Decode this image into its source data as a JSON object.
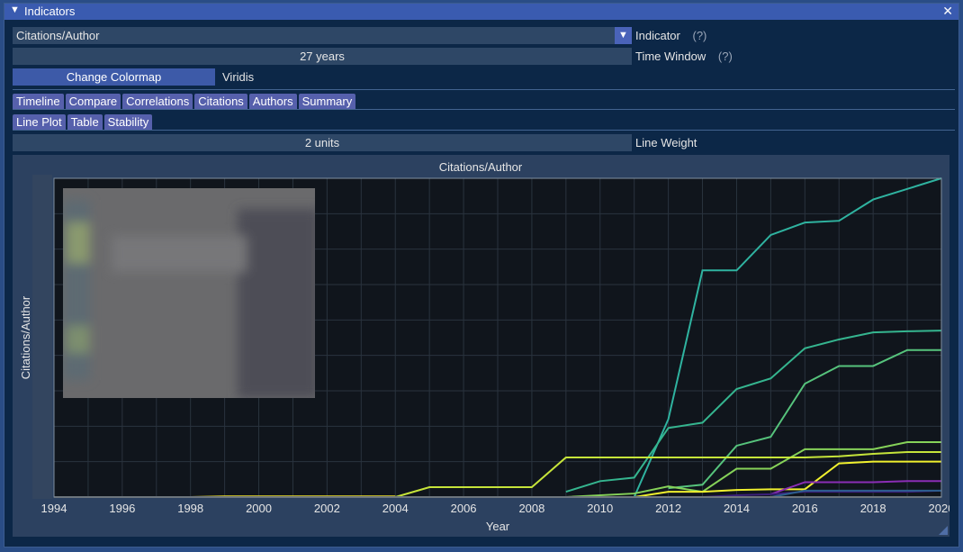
{
  "window": {
    "title": "Indicators"
  },
  "indicator": {
    "value": "Citations/Author",
    "label": "Indicator",
    "help": "(?)"
  },
  "time_window": {
    "value": "27 years",
    "label": "Time Window",
    "help": "(?)"
  },
  "colormap": {
    "button": "Change Colormap",
    "name": "Viridis"
  },
  "tabs": [
    "Timeline",
    "Compare",
    "Correlations",
    "Citations",
    "Authors",
    "Summary"
  ],
  "subtabs": [
    "Line Plot",
    "Table",
    "Stability"
  ],
  "line_weight": {
    "value": "2 units",
    "label": "Line Weight"
  },
  "chart_data": {
    "type": "line",
    "title": "Citations/Author",
    "xlabel": "Year",
    "ylabel": "Citations/Author",
    "xlim": [
      1994,
      2020
    ],
    "ylim": [
      0,
      9
    ],
    "x_ticks": [
      "1994",
      "1996",
      "1998",
      "2000",
      "2002",
      "2004",
      "2006",
      "2008",
      "2010",
      "2012",
      "2014",
      "2016",
      "2018",
      "2020"
    ],
    "grid": true,
    "legend": "top-left (blurred)",
    "series": [
      {
        "color": "#2fb3a0",
        "x": [
          2011,
          2012,
          2013,
          2014,
          2015,
          2016,
          2017,
          2018,
          2019,
          2020
        ],
        "y": [
          0,
          2.2,
          6.4,
          6.4,
          7.4,
          7.75,
          7.8,
          8.4,
          8.7,
          9.0
        ]
      },
      {
        "color": "#35b58f",
        "x": [
          2009,
          2010,
          2011,
          2012,
          2013,
          2014,
          2015,
          2016,
          2017,
          2018,
          2019,
          2020
        ],
        "y": [
          0.15,
          0.45,
          0.55,
          1.95,
          2.1,
          3.05,
          3.35,
          4.2,
          4.45,
          4.65,
          4.68,
          4.7
        ]
      },
      {
        "color": "#56c37c",
        "x": [
          2012,
          2013,
          2014,
          2015,
          2016,
          2017,
          2018,
          2019,
          2020
        ],
        "y": [
          0.25,
          0.35,
          1.45,
          1.7,
          3.2,
          3.7,
          3.7,
          4.15,
          4.15
        ]
      },
      {
        "color": "#86d259",
        "x": [
          2009,
          2011,
          2012,
          2013,
          2014,
          2015,
          2016,
          2017,
          2018,
          2019,
          2020
        ],
        "y": [
          0,
          0.1,
          0.3,
          0.15,
          0.8,
          0.8,
          1.35,
          1.35,
          1.35,
          1.55,
          1.55
        ]
      },
      {
        "color": "#c6e43a",
        "x": [
          2004,
          2005,
          2006,
          2007,
          2008,
          2009,
          2010,
          2011,
          2012,
          2013,
          2014,
          2015,
          2016,
          2017,
          2018,
          2019,
          2020
        ],
        "y": [
          0,
          0.28,
          0.28,
          0.28,
          0.28,
          1.12,
          1.12,
          1.12,
          1.12,
          1.12,
          1.12,
          1.12,
          1.12,
          1.15,
          1.22,
          1.27,
          1.27
        ]
      },
      {
        "color": "#f0f02e",
        "x": [
          2011,
          2012,
          2013,
          2014,
          2015,
          2016,
          2017,
          2018,
          2019,
          2020
        ],
        "y": [
          0,
          0.15,
          0.15,
          0.2,
          0.22,
          0.22,
          0.95,
          1.0,
          1.0,
          1.0
        ]
      },
      {
        "color": "#f6e826",
        "x": [
          1998,
          1999,
          2000,
          2004
        ],
        "y": [
          0,
          0.02,
          0.02,
          0.02
        ]
      },
      {
        "color": "#8a2db5",
        "x": [
          2015,
          2016,
          2017,
          2018,
          2019,
          2020
        ],
        "y": [
          0.08,
          0.42,
          0.42,
          0.42,
          0.45,
          0.45
        ]
      },
      {
        "color": "#3b1f7a",
        "x": [
          2013,
          2014,
          2015,
          2016,
          2017,
          2018,
          2019,
          2020
        ],
        "y": [
          0,
          0.05,
          0.08,
          0.15,
          0.15,
          0.15,
          0.15,
          0.18
        ]
      },
      {
        "color": "#2c5f8e",
        "x": [
          2015,
          2016,
          2017,
          2018,
          2019,
          2020
        ],
        "y": [
          0,
          0.18,
          0.18,
          0.18,
          0.18,
          0.18
        ]
      },
      {
        "color": "#5a5a5a",
        "x": [
          1994,
          2020
        ],
        "y": [
          0,
          0
        ]
      }
    ]
  }
}
